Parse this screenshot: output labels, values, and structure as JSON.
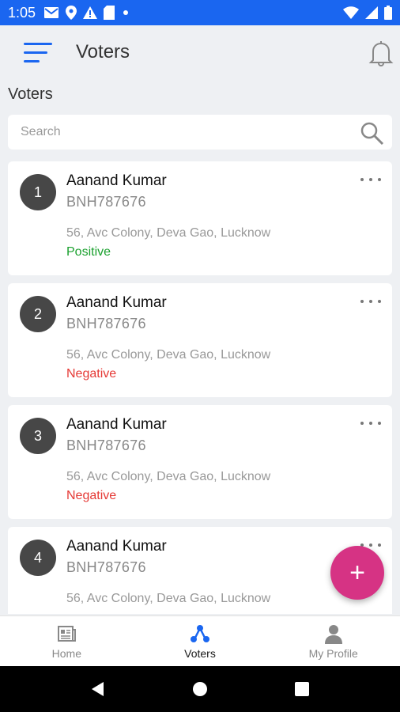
{
  "status_bar": {
    "time": "1:05",
    "icons": [
      "gmail-icon",
      "location-icon",
      "warning-icon",
      "sd-card-icon",
      "dot-icon"
    ],
    "right_icons": [
      "wifi-icon",
      "signal-icon",
      "battery-icon"
    ]
  },
  "app_bar": {
    "title": "Voters",
    "menu_icon": "hamburger-menu-icon",
    "notification_icon": "bell-icon"
  },
  "section_title": "Voters",
  "search": {
    "placeholder": "Search",
    "icon": "search-icon"
  },
  "voters": [
    {
      "number": "1",
      "name": "Aanand Kumar",
      "voter_id": "BNH787676",
      "address": "56, Avc Colony, Deva Gao, Lucknow",
      "status": "Positive",
      "status_color": "#1aa02e"
    },
    {
      "number": "2",
      "name": "Aanand Kumar",
      "voter_id": "BNH787676",
      "address": "56, Avc Colony, Deva Gao, Lucknow",
      "status": "Negative",
      "status_color": "#e53935"
    },
    {
      "number": "3",
      "name": "Aanand Kumar",
      "voter_id": "BNH787676",
      "address": "56, Avc Colony, Deva Gao, Lucknow",
      "status": "Negative",
      "status_color": "#e53935"
    },
    {
      "number": "4",
      "name": "Aanand Kumar",
      "voter_id": "BNH787676",
      "address": "56, Avc Colony, Deva Gao, Lucknow",
      "status": "",
      "status_color": "#e53935"
    }
  ],
  "fab": {
    "label": "+",
    "color": "#d63384"
  },
  "bottom_nav": [
    {
      "label": "Home",
      "icon": "home-document-icon",
      "active": false
    },
    {
      "label": "Voters",
      "icon": "voters-network-icon",
      "active": true
    },
    {
      "label": "My Profile",
      "icon": "profile-icon",
      "active": false
    }
  ],
  "colors": {
    "accent": "#1a66f0",
    "background": "#eef0f3"
  }
}
